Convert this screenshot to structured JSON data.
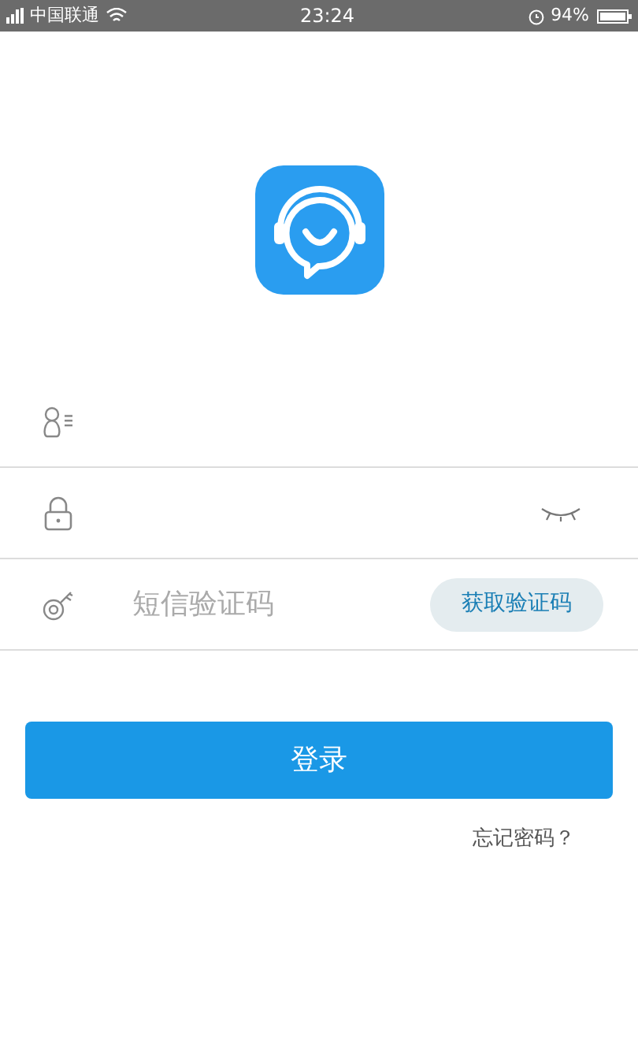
{
  "status_bar": {
    "carrier": "中国联通",
    "time": "23:24",
    "battery": "94%"
  },
  "fields": [
    {
      "kind": "username"
    },
    {
      "kind": "password",
      "masked": true
    },
    {
      "kind": "sms_code",
      "placeholder": "短信验证码",
      "action": "获取验证码"
    }
  ],
  "login_button": "登录",
  "forgot_password": "忘记密码？"
}
